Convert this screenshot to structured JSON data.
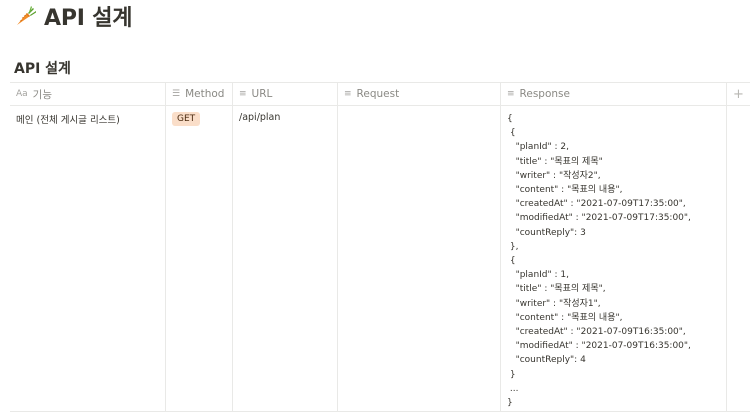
{
  "page": {
    "title": "API 설계",
    "icon": "carrot-icon"
  },
  "database": {
    "title": "API 설계"
  },
  "columns": [
    {
      "label": "기능",
      "icon": "title-icon",
      "icon_glyph": "Aa"
    },
    {
      "label": "Method",
      "icon": "list-icon",
      "icon_glyph": "☰"
    },
    {
      "label": "URL",
      "icon": "text-icon",
      "icon_glyph": "≡"
    },
    {
      "label": "Request",
      "icon": "text-icon",
      "icon_glyph": "≡"
    },
    {
      "label": "Response",
      "icon": "text-icon",
      "icon_glyph": "≡"
    }
  ],
  "add_column_glyph": "+",
  "rows": [
    {
      "feature": "메인 (전체 게시글 리스트)",
      "method": "GET",
      "url": "/api/plan",
      "request": "",
      "response": "{\n {\n   \"planId\" : 2,\n   \"title\" : \"목표의 제목\"\n   \"writer\" : \"작성자2\",\n   \"content\" : \"목표의 내용\",\n   \"createdAt\" : \"2021-07-09T17:35:00\",\n   \"modifiedAt\" : \"2021-07-09T17:35:00\",\n   \"countReply\": 3\n },\n {\n   \"planId\" : 1,\n   \"title\" : \"목표의 제목\",\n   \"writer\" : \"작성자1\",\n   \"content\" : \"목표의 내용\",\n   \"createdAt\" : \"2021-07-09T16:35:00\",\n   \"modifiedAt\" : \"2021-07-09T16:35:00\",\n   \"countReply\": 4\n }\n ...\n}"
    }
  ]
}
